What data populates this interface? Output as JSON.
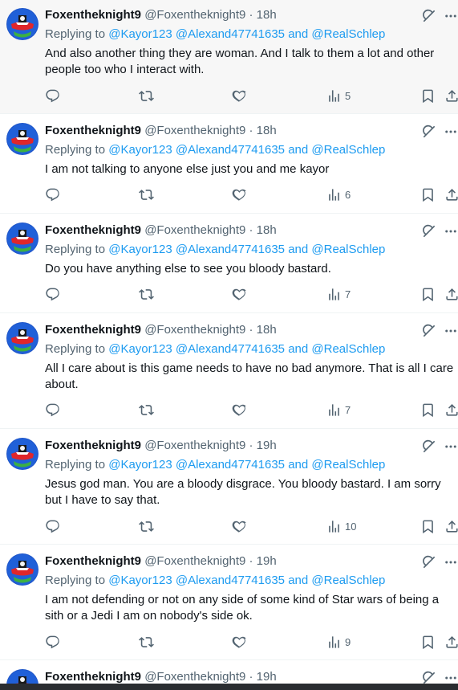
{
  "colors": {
    "accent": "#1d9bf0",
    "muted": "#536471",
    "text": "#0f1419"
  },
  "tweets": [
    {
      "name": "Foxentheknight9",
      "handle": "@Foxentheknight9",
      "dot": "·",
      "time": "18h",
      "replying_label": "Replying to",
      "mentions": [
        "@Kayor123",
        "@Alexand47741635"
      ],
      "and_word": "and",
      "last_mention": "@RealSchlep",
      "text": "And also another thing they are woman. And I talk to them a lot and other people too who I interact with.",
      "views": "5"
    },
    {
      "name": "Foxentheknight9",
      "handle": "@Foxentheknight9",
      "dot": "·",
      "time": "18h",
      "replying_label": "Replying to",
      "mentions": [
        "@Kayor123",
        "@Alexand47741635"
      ],
      "and_word": "and",
      "last_mention": "@RealSchlep",
      "text": "I am not talking to anyone else just you and me kayor",
      "views": "6"
    },
    {
      "name": "Foxentheknight9",
      "handle": "@Foxentheknight9",
      "dot": "·",
      "time": "18h",
      "replying_label": "Replying to",
      "mentions": [
        "@Kayor123",
        "@Alexand47741635"
      ],
      "and_word": "and",
      "last_mention": "@RealSchlep",
      "text": "Do you have anything else to see you bloody bastard.",
      "views": "7"
    },
    {
      "name": "Foxentheknight9",
      "handle": "@Foxentheknight9",
      "dot": "·",
      "time": "18h",
      "replying_label": "Replying to",
      "mentions": [
        "@Kayor123",
        "@Alexand47741635"
      ],
      "and_word": "and",
      "last_mention": "@RealSchlep",
      "text": "All I care about is this game needs to have no bad anymore. That is all I care about.",
      "views": "7"
    },
    {
      "name": "Foxentheknight9",
      "handle": "@Foxentheknight9",
      "dot": "·",
      "time": "19h",
      "replying_label": "Replying to",
      "mentions": [
        "@Kayor123",
        "@Alexand47741635"
      ],
      "and_word": "and",
      "last_mention": "@RealSchlep",
      "text": "Jesus god man. You are a bloody disgrace. You bloody bastard. I am sorry but I have to say that.",
      "views": "10"
    },
    {
      "name": "Foxentheknight9",
      "handle": "@Foxentheknight9",
      "dot": "·",
      "time": "19h",
      "replying_label": "Replying to",
      "mentions": [
        "@Kayor123",
        "@Alexand47741635"
      ],
      "and_word": "and",
      "last_mention": "@RealSchlep",
      "text": "I am not defending or not on any side of some kind of Star wars of being a sith or a Jedi I am on nobody's side ok.",
      "views": "9"
    },
    {
      "name": "Foxentheknight9",
      "handle": "@Foxentheknight9",
      "dot": "·",
      "time": "19h"
    }
  ],
  "icons": {
    "reply": "reply-icon",
    "retweet": "retweet-icon",
    "like": "heart-icon",
    "views": "views-chart-icon",
    "bookmark": "bookmark-icon",
    "share": "share-icon",
    "grok": "grok-icon",
    "more": "more-dots-icon"
  }
}
